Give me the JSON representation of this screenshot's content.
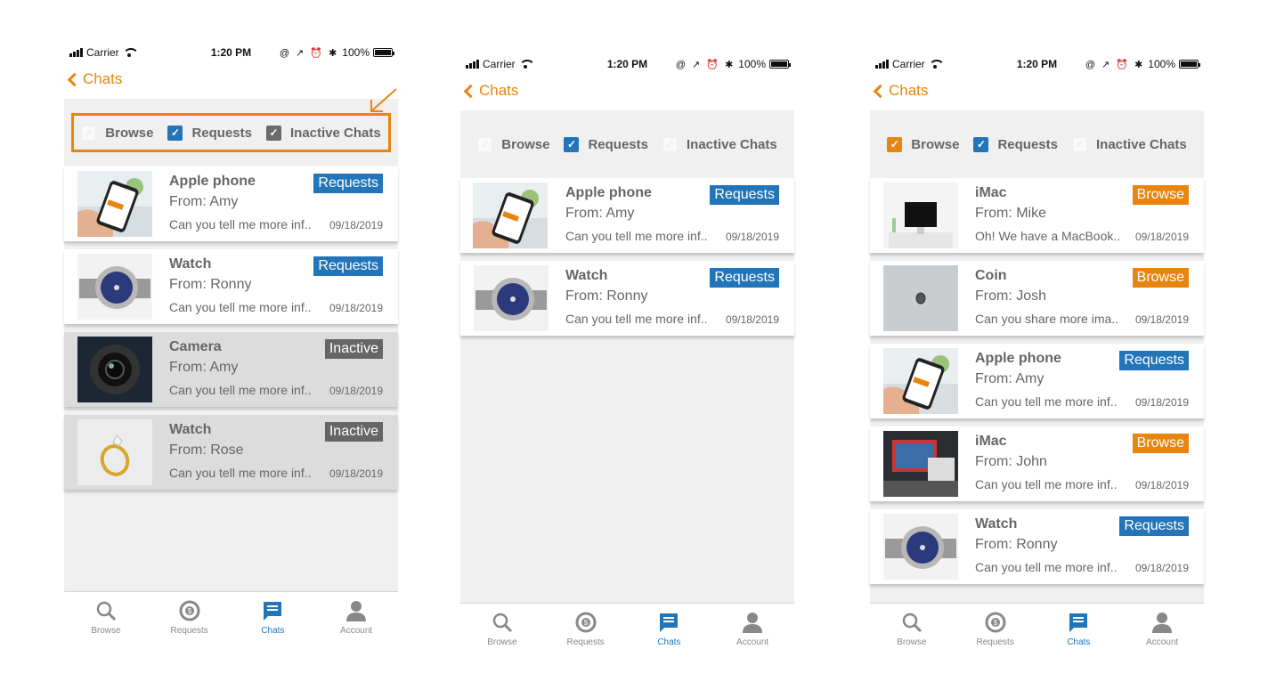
{
  "status": {
    "carrier": "Carrier",
    "time": "1:20 PM",
    "battery": "100%",
    "icons": "@ ↗ ⏰ ✱"
  },
  "nav": {
    "back_label": "Chats"
  },
  "filters": {
    "browse": "Browse",
    "requests": "Requests",
    "inactive": "Inactive Chats"
  },
  "tabs": {
    "browse": "Browse",
    "requests": "Requests",
    "chats": "Chats",
    "account": "Account"
  },
  "colors": {
    "accent": "#e8850f",
    "blue": "#2275b8",
    "inactive": "#666666"
  },
  "screen1": {
    "items": [
      {
        "title": "Apple phone",
        "from": "From: Amy",
        "msg": "Can you tell me more inf..",
        "date": "09/18/2019",
        "badge": "Requests"
      },
      {
        "title": "Watch",
        "from": "From: Ronny",
        "msg": "Can you tell me more inf..",
        "date": "09/18/2019",
        "badge": "Requests"
      },
      {
        "title": "Camera",
        "from": "From: Amy",
        "msg": "Can you tell me more inf..",
        "date": "09/18/2019",
        "badge": "Inactive"
      },
      {
        "title": "Watch",
        "from": "From: Rose",
        "msg": "Can you tell me more inf..",
        "date": "09/18/2019",
        "badge": "Inactive"
      }
    ]
  },
  "screen2": {
    "items": [
      {
        "title": "Apple phone",
        "from": "From: Amy",
        "msg": "Can you tell me more inf..",
        "date": "09/18/2019",
        "badge": "Requests"
      },
      {
        "title": "Watch",
        "from": "From: Ronny",
        "msg": "Can you tell me more inf..",
        "date": "09/18/2019",
        "badge": "Requests"
      }
    ]
  },
  "screen3": {
    "items": [
      {
        "title": "iMac",
        "from": "From: Mike",
        "msg": "Oh! We have a MacBook..",
        "date": "09/18/2019",
        "badge": "Browse"
      },
      {
        "title": "Coin",
        "from": "From: Josh",
        "msg": "Can you share more ima..",
        "date": "09/18/2019",
        "badge": "Browse"
      },
      {
        "title": "Apple phone",
        "from": "From: Amy",
        "msg": "Can you tell me more inf..",
        "date": "09/18/2019",
        "badge": "Requests"
      },
      {
        "title": "iMac",
        "from": "From: John",
        "msg": "Can you tell me more inf..",
        "date": "09/18/2019",
        "badge": "Browse"
      },
      {
        "title": "Watch",
        "from": "From: Ronny",
        "msg": "Can you tell me more inf..",
        "date": "09/18/2019",
        "badge": "Requests"
      }
    ]
  }
}
